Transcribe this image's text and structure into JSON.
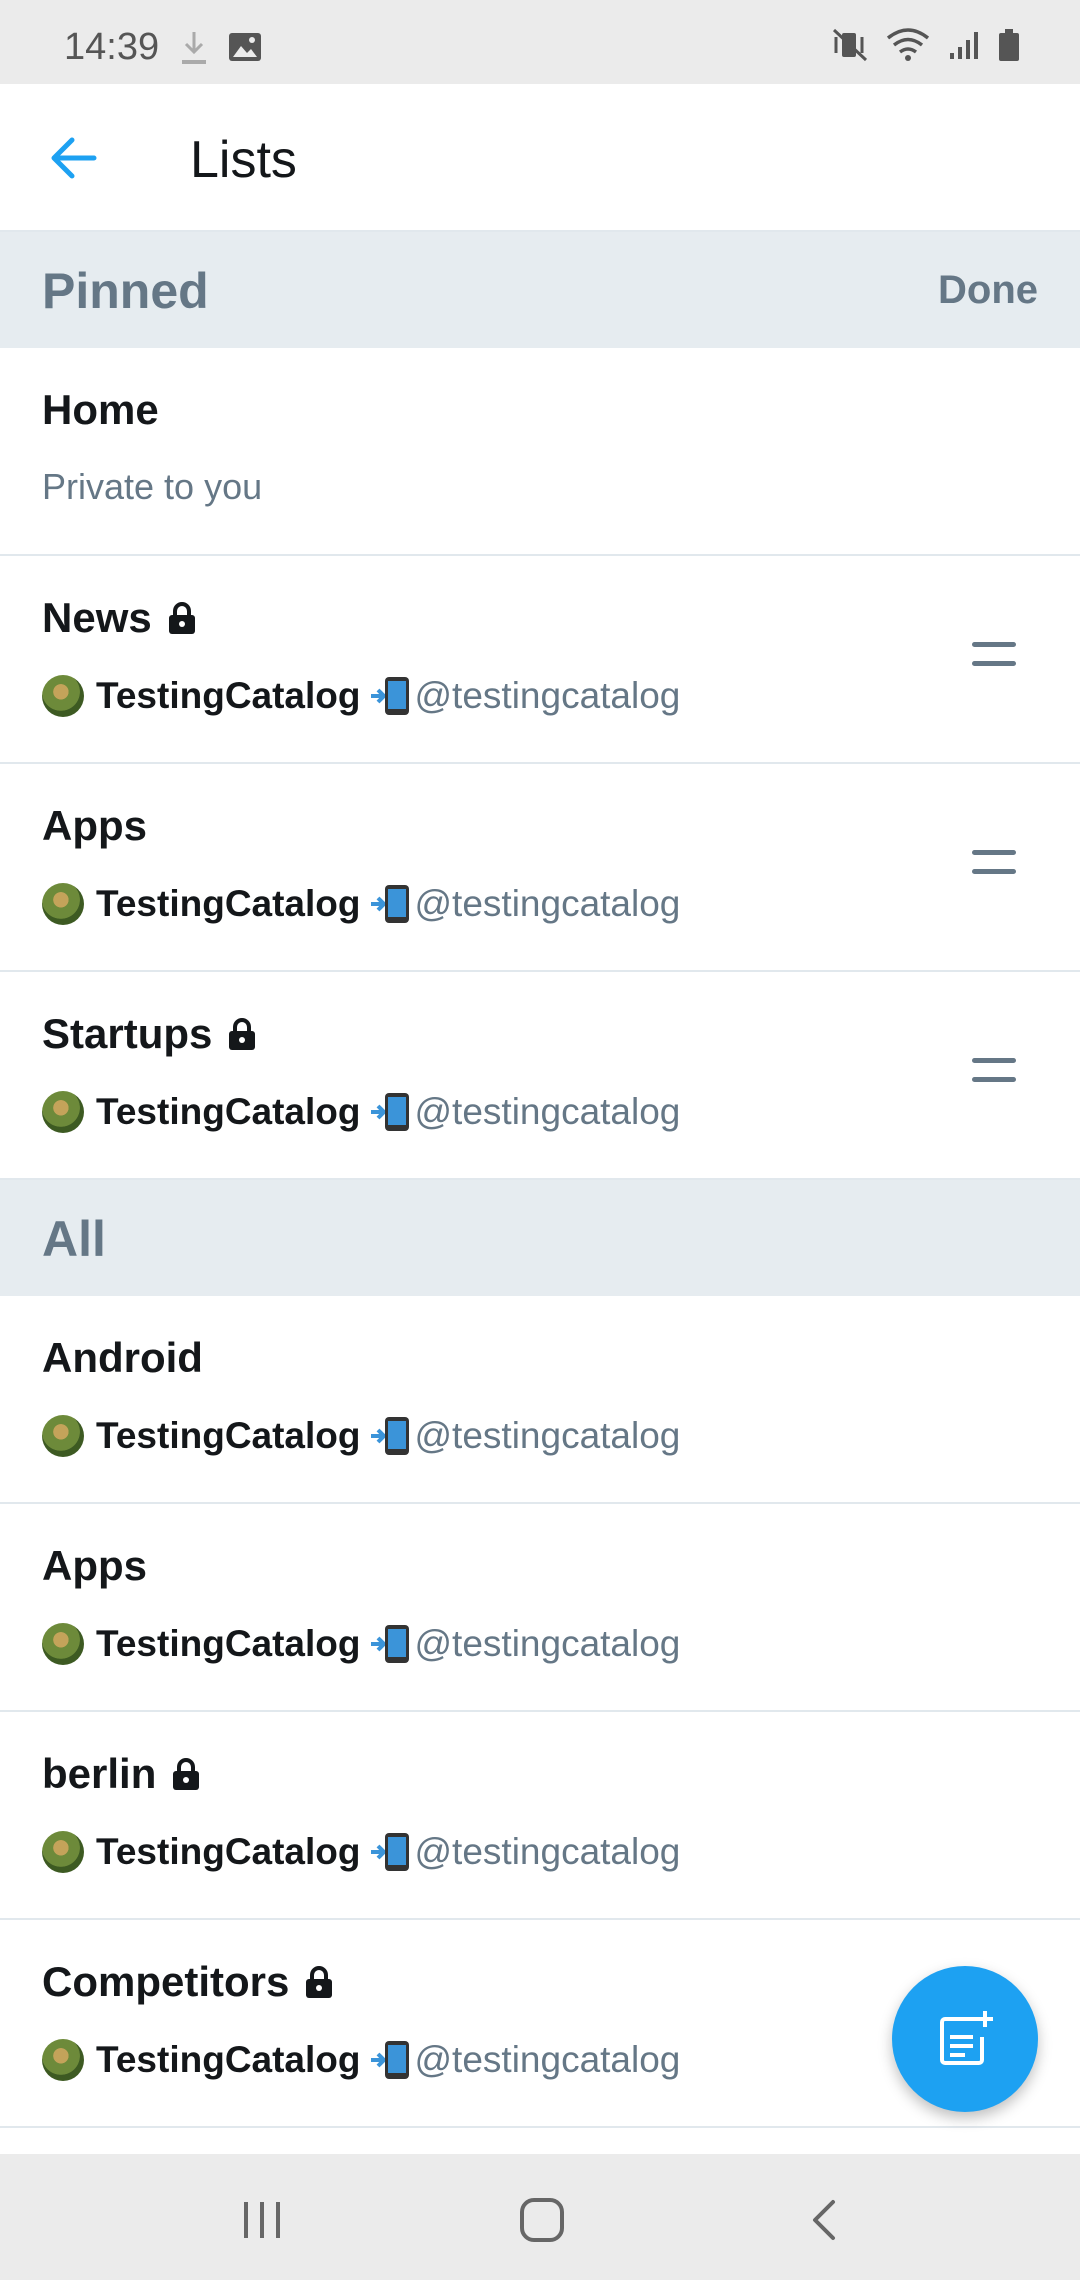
{
  "status_bar": {
    "time": "14:39",
    "icons": [
      "download-icon",
      "image-icon",
      "vibrate-mute-icon",
      "wifi-icon",
      "signal-icon",
      "battery-icon"
    ]
  },
  "app_bar": {
    "title": "Lists",
    "back_icon": "arrow-left-icon",
    "accent_color": "#1da1f2"
  },
  "pinned_section": {
    "title": "Pinned",
    "done_label": "Done",
    "items": [
      {
        "name": "Home",
        "subtitle": "Private to you",
        "locked": false
      },
      {
        "name": "News",
        "owner": "TestingCatalog",
        "handle": "@testingcatalog",
        "locked": true
      },
      {
        "name": "Apps",
        "owner": "TestingCatalog",
        "handle": "@testingcatalog",
        "locked": false
      },
      {
        "name": "Startups",
        "owner": "TestingCatalog",
        "handle": "@testingcatalog",
        "locked": true
      }
    ]
  },
  "all_section": {
    "title": "All",
    "items": [
      {
        "name": "Android",
        "owner": "TestingCatalog",
        "handle": "@testingcatalog",
        "locked": false
      },
      {
        "name": "Apps",
        "owner": "TestingCatalog",
        "handle": "@testingcatalog",
        "locked": false
      },
      {
        "name": "berlin",
        "owner": "TestingCatalog",
        "handle": "@testingcatalog",
        "locked": true
      },
      {
        "name": "Competitors",
        "owner": "TestingCatalog",
        "handle": "@testingcatalog",
        "locked": true
      }
    ]
  },
  "fab": {
    "icon": "new-list-icon"
  },
  "nav_bar": {
    "icons": [
      "recents-icon",
      "home-icon",
      "back-icon"
    ]
  }
}
